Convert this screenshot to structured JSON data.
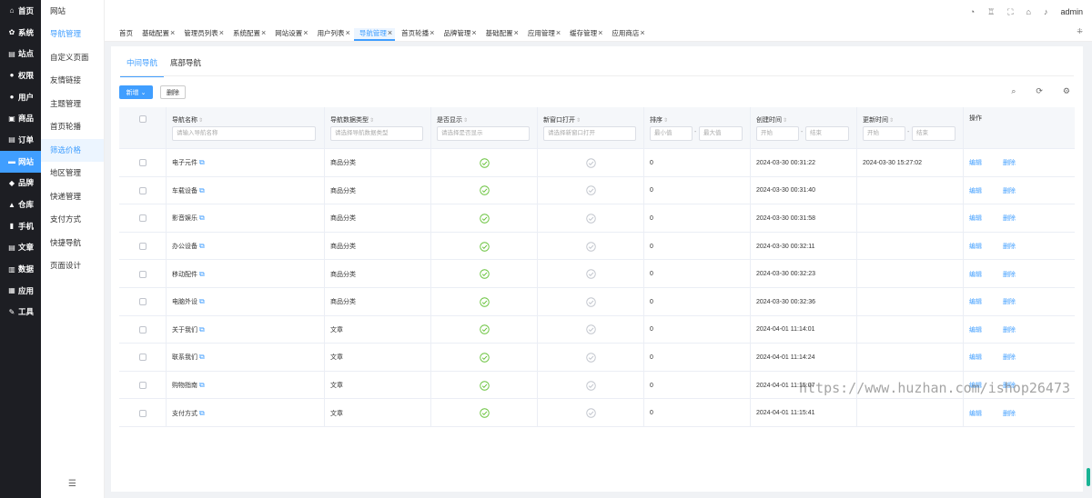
{
  "sidebar1": {
    "items": [
      {
        "icon": "home-icon",
        "glyph": "⌂",
        "label": "首页"
      },
      {
        "icon": "gear-icon",
        "glyph": "✿",
        "label": "系统"
      },
      {
        "icon": "site-icon",
        "glyph": "▤",
        "label": "站点"
      },
      {
        "icon": "user-key-icon",
        "glyph": "●",
        "label": "权限"
      },
      {
        "icon": "user-icon",
        "glyph": "●",
        "label": "用户"
      },
      {
        "icon": "goods-icon",
        "glyph": "▣",
        "label": "商品"
      },
      {
        "icon": "order-icon",
        "glyph": "▤",
        "label": "订单"
      },
      {
        "icon": "website-icon",
        "glyph": "▬",
        "label": "网站"
      },
      {
        "icon": "brand-icon",
        "glyph": "◆",
        "label": "品牌"
      },
      {
        "icon": "warehouse-icon",
        "glyph": "▲",
        "label": "仓库"
      },
      {
        "icon": "phone-icon",
        "glyph": "▮",
        "label": "手机"
      },
      {
        "icon": "article-icon",
        "glyph": "▤",
        "label": "文章"
      },
      {
        "icon": "chart-icon",
        "glyph": "▥",
        "label": "数据"
      },
      {
        "icon": "apps-icon",
        "glyph": "▦",
        "label": "应用"
      },
      {
        "icon": "wrench-icon",
        "glyph": "✎",
        "label": "工具"
      }
    ],
    "active_index": 7
  },
  "sidebar2": {
    "title": "网站",
    "items": [
      "导航管理",
      "自定义页面",
      "友情链接",
      "主题管理",
      "首页轮播",
      "筛选价格",
      "地区管理",
      "快递管理",
      "支付方式",
      "快捷导航",
      "页面设计"
    ],
    "active_index": 0,
    "selected_index": 5,
    "collapse_glyph": "☰"
  },
  "topbar": {
    "icons": [
      "◔",
      "♖",
      "⛶",
      "⌂",
      "♪"
    ],
    "user": "admin"
  },
  "tabs": [
    {
      "label": "首页",
      "closable": false
    },
    {
      "label": "基础配置",
      "closable": true
    },
    {
      "label": "管理员列表",
      "closable": true
    },
    {
      "label": "系统配置",
      "closable": true
    },
    {
      "label": "网站设置",
      "closable": true
    },
    {
      "label": "用户列表",
      "closable": true
    },
    {
      "label": "导航管理",
      "closable": true,
      "active": true
    },
    {
      "label": "首页轮播",
      "closable": true
    },
    {
      "label": "品牌管理",
      "closable": true
    },
    {
      "label": "基础配置",
      "closable": true
    },
    {
      "label": "应用管理",
      "closable": true
    },
    {
      "label": "缓存管理",
      "closable": true
    },
    {
      "label": "应用商店",
      "closable": true
    }
  ],
  "subtabs": [
    "中间导航",
    "底部导航"
  ],
  "toolbar": {
    "add_label": "新增",
    "add_caret": "⌄",
    "delete_label": "删除"
  },
  "columns": {
    "name": {
      "label": "导航名称",
      "placeholder": "请输入导航名称"
    },
    "type": {
      "label": "导航数据类型",
      "placeholder": "请选择导航数据类型"
    },
    "show": {
      "label": "是否显示",
      "placeholder": "请选择是否显示"
    },
    "newwin": {
      "label": "新窗口打开",
      "placeholder": "请选择新窗口打开"
    },
    "sort": {
      "label": "排序",
      "min_placeholder": "最小值",
      "max_placeholder": "最大值"
    },
    "created": {
      "label": "创建时间",
      "start_placeholder": "开始",
      "end_placeholder": "结束"
    },
    "updated": {
      "label": "更新时间",
      "start_placeholder": "开始",
      "end_placeholder": "结束"
    },
    "op": {
      "label": "操作"
    }
  },
  "rows": [
    {
      "name": "电子元件",
      "type": "商品分类",
      "show": true,
      "newwin": false,
      "sort": "0",
      "created": "2024-03-30 00:31:22",
      "updated": "2024-03-30 15:27:02"
    },
    {
      "name": "车载设备",
      "type": "商品分类",
      "show": true,
      "newwin": false,
      "sort": "0",
      "created": "2024-03-30 00:31:40",
      "updated": ""
    },
    {
      "name": "影音娱乐",
      "type": "商品分类",
      "show": true,
      "newwin": false,
      "sort": "0",
      "created": "2024-03-30 00:31:58",
      "updated": ""
    },
    {
      "name": "办公设备",
      "type": "商品分类",
      "show": true,
      "newwin": false,
      "sort": "0",
      "created": "2024-03-30 00:32:11",
      "updated": ""
    },
    {
      "name": "移动配件",
      "type": "商品分类",
      "show": true,
      "newwin": false,
      "sort": "0",
      "created": "2024-03-30 00:32:23",
      "updated": ""
    },
    {
      "name": "电脑外设",
      "type": "商品分类",
      "show": true,
      "newwin": false,
      "sort": "0",
      "created": "2024-03-30 00:32:36",
      "updated": ""
    },
    {
      "name": "关于我们",
      "type": "文章",
      "show": true,
      "newwin": false,
      "sort": "0",
      "created": "2024-04-01 11:14:01",
      "updated": ""
    },
    {
      "name": "联系我们",
      "type": "文章",
      "show": true,
      "newwin": false,
      "sort": "0",
      "created": "2024-04-01 11:14:24",
      "updated": ""
    },
    {
      "name": "购物指南",
      "type": "文章",
      "show": true,
      "newwin": false,
      "sort": "0",
      "created": "2024-04-01 11:15:07",
      "updated": ""
    },
    {
      "name": "支付方式",
      "type": "文章",
      "show": true,
      "newwin": false,
      "sort": "0",
      "created": "2024-04-01 11:15:41",
      "updated": ""
    }
  ],
  "row_actions": {
    "edit": "编辑",
    "delete": "删除"
  },
  "watermark": "https://www.huzhan.com/ishop26473",
  "colors": {
    "primary": "#409eff",
    "sidebar_bg": "#1d1e23",
    "ok_green": "#67c23a",
    "ok_gray": "#c0c4cc"
  }
}
